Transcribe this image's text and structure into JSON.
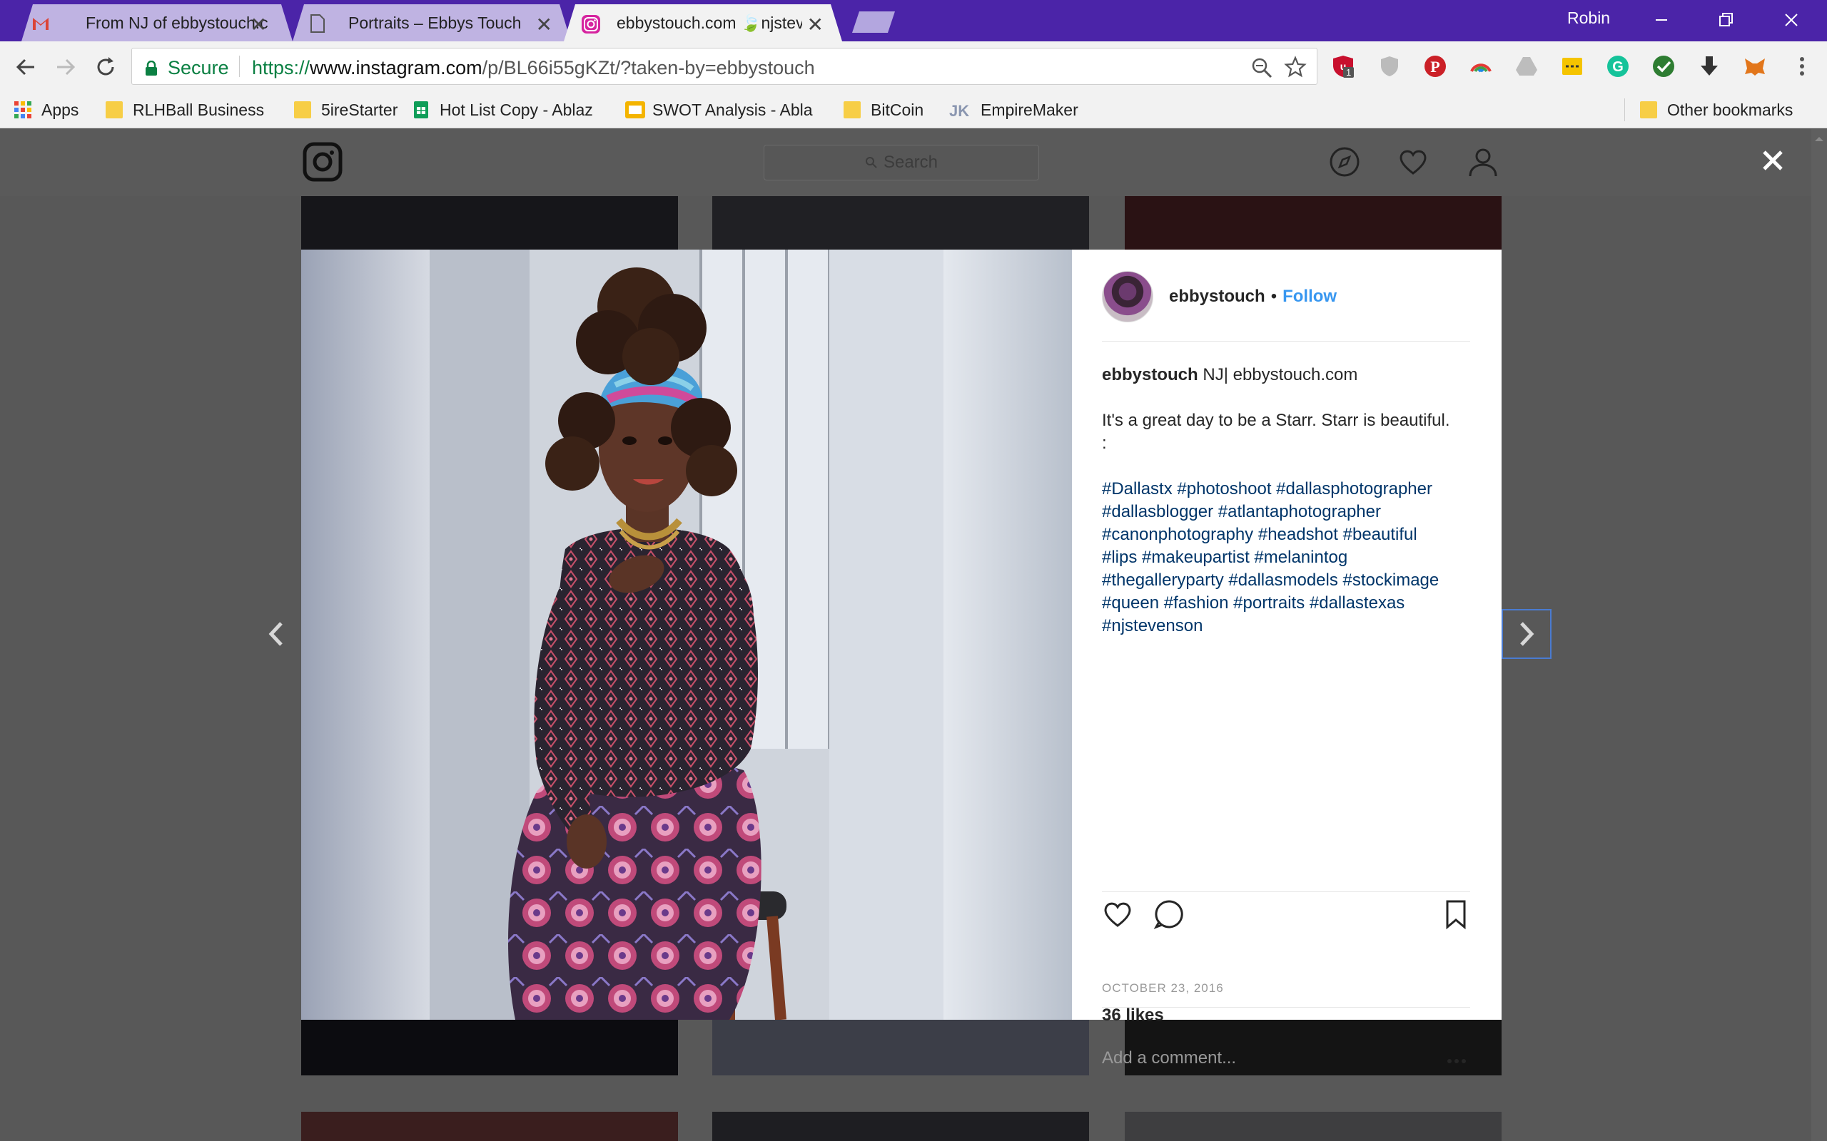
{
  "browser": {
    "tabs": [
      {
        "title": "From NJ of ebbystouch.c",
        "icon": "gmail-icon"
      },
      {
        "title": "Portraits – Ebbys Touch",
        "icon": "document-icon"
      },
      {
        "title": "ebbystouch.com 🍃njstev",
        "icon": "instagram-icon"
      }
    ],
    "profile_name": "Robin",
    "secure_label": "Secure",
    "url_scheme": "https://",
    "url_host": "www.instagram.com",
    "url_path": "/p/BL66i55gKZt/?taken-by=ebbystouch",
    "extension_badge": "1"
  },
  "bookmarks": {
    "apps": "Apps",
    "items": [
      {
        "label": "RLHBall Business",
        "icon": "folder-icon"
      },
      {
        "label": "5ireStarter",
        "icon": "folder-icon"
      },
      {
        "label": "Hot List Copy - Ablaz",
        "icon": "sheets-icon"
      },
      {
        "label": "SWOT Analysis - Abla",
        "icon": "slides-icon"
      },
      {
        "label": "BitCoin",
        "icon": "folder-icon"
      },
      {
        "label": "EmpireMaker",
        "icon": "jk-icon"
      }
    ],
    "other": "Other bookmarks"
  },
  "instagram": {
    "search_placeholder": "Search",
    "post": {
      "username": "ebbystouch",
      "separator": "•",
      "follow_label": "Follow",
      "caption_user": "ebbystouch",
      "caption_lead": " NJ| ebbystouch.com",
      "caption_line2": "It's a great day to be a Starr. Starr is beautiful.",
      "caption_line3": ":",
      "hashtags_lines": [
        "#Dallastx #photoshoot #dallasphotographer",
        "#dallasblogger #atlantaphotographer",
        "#canonphotography #headshot #beautiful",
        "#lips #makeupartist #melanintog",
        "#thegalleryparty #dallasmodels #stockimage",
        "#queen #fashion #portraits #dallastexas",
        "#njstevenson"
      ],
      "likes": "36 likes",
      "date": "OCTOBER 23, 2016",
      "comment_placeholder": "Add a comment...",
      "more": "..."
    }
  },
  "colors": {
    "titlebar": "#4b24a8",
    "link_blue": "#3897f0",
    "hashtag": "#003569"
  }
}
